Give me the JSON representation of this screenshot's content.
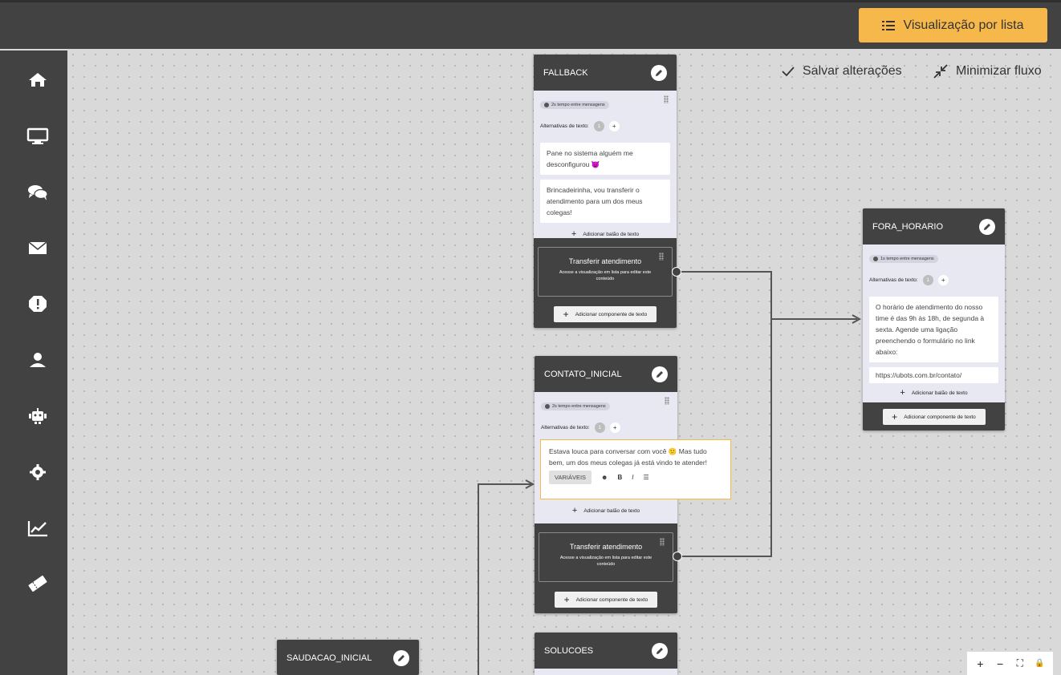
{
  "topbar": {
    "list_view_label": "Visualização por lista",
    "list_icon": "list-icon"
  },
  "sidebar": {
    "items": [
      {
        "icon": "home-icon"
      },
      {
        "icon": "monitor-icon"
      },
      {
        "icon": "chat-icon"
      },
      {
        "icon": "mail-icon"
      },
      {
        "icon": "alert-icon"
      },
      {
        "icon": "user-icon"
      },
      {
        "icon": "robot-icon"
      },
      {
        "icon": "gear-icon"
      },
      {
        "icon": "chart-icon"
      },
      {
        "icon": "ticket-icon"
      }
    ]
  },
  "canvas": {
    "save_label": "Salvar alterações",
    "minimize_label": "Minimizar fluxo"
  },
  "nodes": {
    "fallback": {
      "title": "FALLBACK",
      "time": "2s tempo entre mensagens",
      "alt_label": "Alternativas de texto:",
      "alt_count": "1",
      "bubbles": [
        "Pane no sistema alguém me desconfigurou 😈",
        "Brincadeirinha, vou transferir o atendimento para um dos meus colegas!"
      ],
      "add_bubble": "Adicionar balão de texto",
      "transfer_title": "Transferir atendimento",
      "transfer_sub": "Acesse a visualização em lista para editar este conteúdo",
      "add_component": "Adicionar componente de texto"
    },
    "contato_inicial": {
      "title": "CONTATO_INICIAL",
      "time": "2s tempo entre mensagens",
      "alt_label": "Alternativas de texto:",
      "alt_count": "1",
      "editor_text": "Estava louca para conversar com você 🙂 Mas tudo bem, um dos meus colegas já está vindo te atender!",
      "variables_label": "VARIÁVEIS",
      "add_bubble": "Adicionar balão de texto",
      "transfer_title": "Transferir atendimento",
      "transfer_sub": "Acesse a visualização em lista para editar este conteúdo",
      "add_component": "Adicionar componente de texto"
    },
    "fora_horario": {
      "title": "FORA_HORARIO",
      "time": "1s tempo entre mensagens",
      "alt_label": "Alternativas de texto:",
      "alt_count": "1",
      "bubbles": [
        "O horário de atendimento do nosso time é das 9h às 18h, de segunda à sexta.  Agende uma ligação preenchendo o formulário no link abaixo:",
        "https://ubots.com.br/contato/"
      ],
      "add_bubble": "Adicionar balão de texto",
      "add_component": "Adicionar componente de texto"
    },
    "solucoes": {
      "title": "SOLUCOES"
    },
    "saudacao_inicial": {
      "title": "SAUDACAO_INICIAL"
    }
  },
  "zoom": {
    "zoom_in": "+",
    "zoom_out": "−",
    "fit": "⛶",
    "lock": "🔒"
  }
}
